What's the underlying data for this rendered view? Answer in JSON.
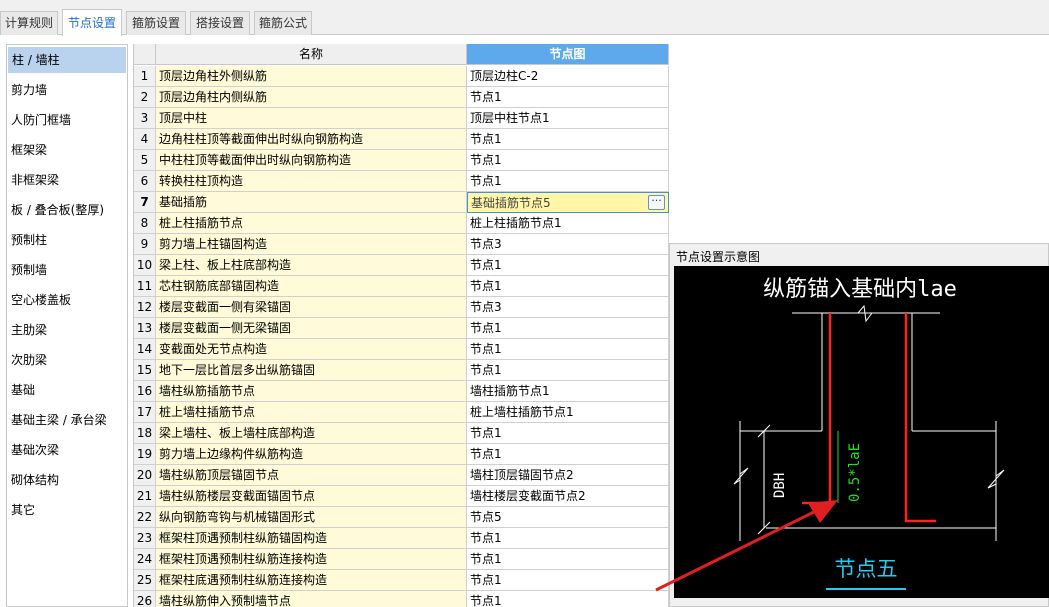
{
  "tabs": [
    {
      "label": "计算规则",
      "active": false
    },
    {
      "label": "节点设置",
      "active": true
    },
    {
      "label": "箍筋设置",
      "active": false
    },
    {
      "label": "搭接设置",
      "active": false
    },
    {
      "label": "箍筋公式",
      "active": false
    }
  ],
  "sidebar": {
    "items": [
      {
        "label": "柱 / 墙柱",
        "active": true
      },
      {
        "label": "剪力墙"
      },
      {
        "label": "人防门框墙"
      },
      {
        "label": "框架梁"
      },
      {
        "label": "非框架梁"
      },
      {
        "label": "板 / 叠合板(整厚)"
      },
      {
        "label": "预制柱"
      },
      {
        "label": "预制墙"
      },
      {
        "label": "空心楼盖板"
      },
      {
        "label": "主肋梁"
      },
      {
        "label": "次肋梁"
      },
      {
        "label": "基础"
      },
      {
        "label": "基础主梁 / 承台梁"
      },
      {
        "label": "基础次梁"
      },
      {
        "label": "砌体结构"
      },
      {
        "label": "其它"
      }
    ]
  },
  "grid": {
    "columns": [
      "名称",
      "节点图"
    ],
    "current_row": 7,
    "ellipsis": "···",
    "rows": [
      {
        "num": "1",
        "name": "顶层边角柱外侧纵筋",
        "node": "顶层边柱C-2"
      },
      {
        "num": "2",
        "name": "顶层边角柱内侧纵筋",
        "node": "节点1"
      },
      {
        "num": "3",
        "name": "顶层中柱",
        "node": "顶层中柱节点1"
      },
      {
        "num": "4",
        "name": "边角柱柱顶等截面伸出时纵向钢筋构造",
        "node": "节点1"
      },
      {
        "num": "5",
        "name": "中柱柱顶等截面伸出时纵向钢筋构造",
        "node": "节点1"
      },
      {
        "num": "6",
        "name": "转换柱柱顶构造",
        "node": "节点1"
      },
      {
        "num": "7",
        "name": "基础插筋",
        "node": "基础插筋节点5"
      },
      {
        "num": "8",
        "name": "桩上柱插筋节点",
        "node": "桩上柱插筋节点1"
      },
      {
        "num": "9",
        "name": "剪力墙上柱锚固构造",
        "node": "节点3"
      },
      {
        "num": "10",
        "name": "梁上柱、板上柱底部构造",
        "node": "节点1"
      },
      {
        "num": "11",
        "name": "芯柱钢筋底部锚固构造",
        "node": "节点1"
      },
      {
        "num": "12",
        "name": "楼层变截面一侧有梁锚固",
        "node": "节点3"
      },
      {
        "num": "13",
        "name": "楼层变截面一侧无梁锚固",
        "node": "节点1"
      },
      {
        "num": "14",
        "name": "变截面处无节点构造",
        "node": "节点1"
      },
      {
        "num": "15",
        "name": "地下一层比首层多出纵筋锚固",
        "node": "节点1"
      },
      {
        "num": "16",
        "name": "墙柱纵筋插筋节点",
        "node": "墙柱插筋节点1"
      },
      {
        "num": "17",
        "name": "桩上墙柱插筋节点",
        "node": "桩上墙柱插筋节点1"
      },
      {
        "num": "18",
        "name": "梁上墙柱、板上墙柱底部构造",
        "node": "节点1"
      },
      {
        "num": "19",
        "name": "剪力墙上边缘构件纵筋构造",
        "node": "节点1"
      },
      {
        "num": "20",
        "name": "墙柱纵筋顶层锚固节点",
        "node": "墙柱顶层锚固节点2"
      },
      {
        "num": "21",
        "name": "墙柱纵筋楼层变截面锚固节点",
        "node": "墙柱楼层变截面节点2"
      },
      {
        "num": "22",
        "name": "纵向钢筋弯钩与机械锚固形式",
        "node": "节点5"
      },
      {
        "num": "23",
        "name": "框架柱顶遇预制柱纵筋锚固构造",
        "node": "节点1"
      },
      {
        "num": "24",
        "name": "框架柱顶遇预制柱纵筋连接构造",
        "node": "节点1"
      },
      {
        "num": "25",
        "name": "框架柱底遇预制柱纵筋连接构造",
        "node": "节点1"
      },
      {
        "num": "26",
        "name": "墙柱纵筋伸入预制墙节点",
        "node": "节点1"
      }
    ]
  },
  "preview": {
    "title": "节点设置示意图",
    "diagram": {
      "heading": "纵筋锚入基础内lae",
      "dim_vertical": "DBH",
      "anchor_label": "0.5*laE",
      "node_name": "节点五"
    }
  },
  "colors": {
    "accent_blue": "#5ea9ee",
    "name_bg": "#fffbd8",
    "rebar_red": "#ff2020",
    "dim_green": "#22dd22",
    "caption_cyan": "#22ccee",
    "arrow_red": "#e02020"
  }
}
